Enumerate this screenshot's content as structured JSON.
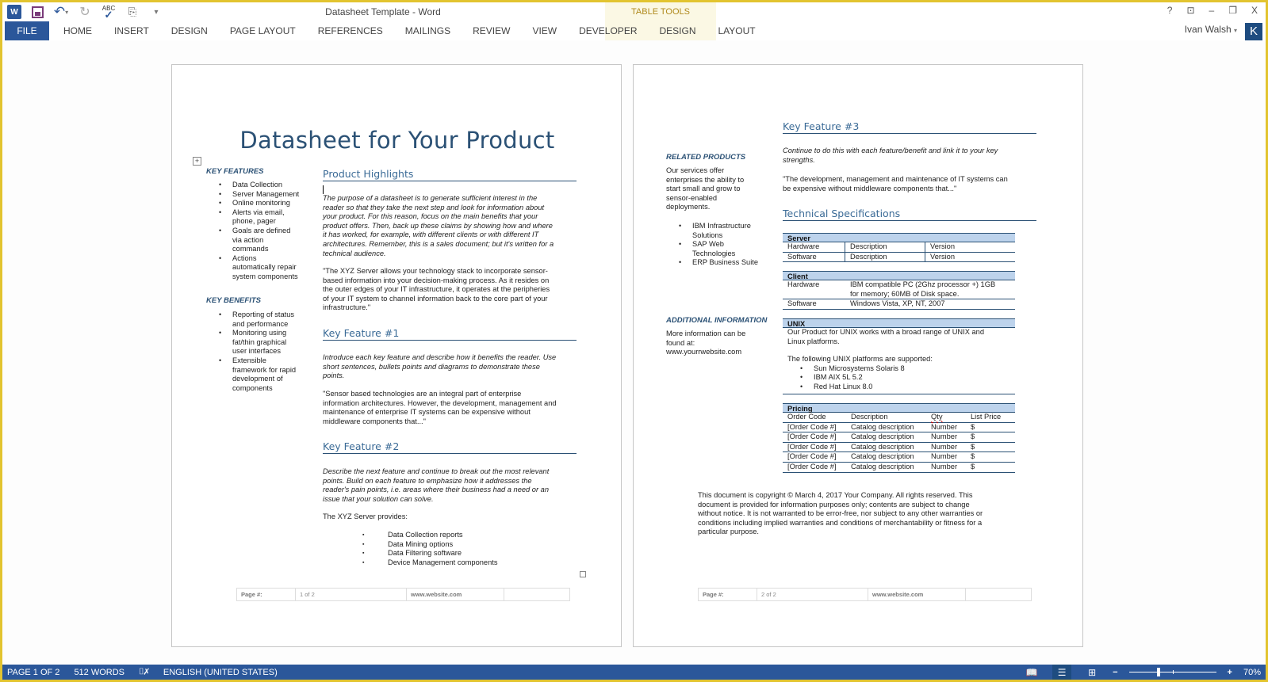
{
  "app": {
    "window_title": "Datasheet Template - Word",
    "table_tools_label": "TABLE TOOLS",
    "user_name": "Ivan Walsh",
    "user_initial": "K",
    "accent_color": "#2b579a",
    "frame_color": "#e2c430"
  },
  "quick_access": {
    "items": [
      "word-logo",
      "save",
      "undo",
      "redo",
      "spelling-check",
      "touch-mode",
      "customize"
    ]
  },
  "window_controls": {
    "help": "?",
    "ribbon_display": "⊡",
    "minimize": "–",
    "restore": "❐",
    "close": "X"
  },
  "ribbon": {
    "tabs": [
      "FILE",
      "HOME",
      "INSERT",
      "DESIGN",
      "PAGE LAYOUT",
      "REFERENCES",
      "MAILINGS",
      "REVIEW",
      "VIEW",
      "DEVELOPER"
    ],
    "contextual_tabs": [
      "DESIGN",
      "LAYOUT"
    ]
  },
  "page1": {
    "title": "Datasheet for Your Product",
    "key_features": {
      "heading": "KEY FEATURES",
      "items": [
        [
          "Data Collection"
        ],
        [
          "Server Management"
        ],
        [
          "Online monitoring"
        ],
        [
          "Alerts via email,",
          "phone, pager"
        ],
        [
          "Goals are defined",
          "via action",
          "commands"
        ],
        [
          "Actions",
          "automatically repair",
          "system components"
        ]
      ]
    },
    "key_benefits": {
      "heading": "KEY BENEFITS",
      "items": [
        [
          "Reporting of status",
          "and performance"
        ],
        [
          "Monitoring using",
          "fat/thin graphical",
          "user interfaces"
        ],
        [
          "Extensible",
          "framework for rapid",
          "development of",
          "components"
        ]
      ]
    },
    "product_highlights": {
      "heading": "Product Highlights",
      "intro_lines": [
        "The purpose of a datasheet is to generate sufficient interest in the",
        "reader so that they take the next step and look for information about",
        "your product. For this reason, focus on the main benefits that your",
        "product offers. Then, back up these claims by showing how and where",
        "it has worked, for example, with different clients or with different IT",
        "architectures. Remember, this is a sales document; but it's written for a",
        "technical audience."
      ],
      "quote_lines": [
        "\"The XYZ Server allows your technology stack to incorporate sensor-",
        "based information into your decision-making process. As it resides on",
        "the outer edges of your IT infrastructure, it operates at the peripheries",
        "of your IT system to channel information back to the core part of your",
        "infrastructure.\""
      ]
    },
    "key_feature_1": {
      "heading": "Key Feature #1",
      "intro_lines": [
        "Introduce each key feature and describe how it benefits the reader. Use",
        "short sentences, bullets points and diagrams to demonstrate these",
        "points."
      ],
      "quote_lines": [
        "\"Sensor based technologies are an integral part of enterprise",
        "information architectures. However, the development, management and",
        "maintenance of enterprise IT systems can be expensive without",
        "middleware components that...\""
      ]
    },
    "key_feature_2": {
      "heading": "Key Feature #2",
      "intro_lines": [
        "Describe the next feature and continue to break out the most relevant",
        "points. Build on each feature to emphasize how it addresses the",
        "reader's pain points, i.e. areas where their business had a need or an",
        "issue that your solution can solve."
      ],
      "provides_label": "The XYZ Server provides:",
      "provides_items": [
        "Data Collection reports",
        "Data Mining options",
        "Data Filtering software",
        "Device Management components"
      ]
    },
    "footer": {
      "page_label": "Page #:",
      "page_value": "1 of 2",
      "website": "www.website.com",
      "extra": ""
    }
  },
  "page2": {
    "related_products": {
      "heading": "RELATED PRODUCTS",
      "text_lines": [
        "Our services offer",
        "enterprises the ability to",
        "start small and grow to",
        "sensor-enabled",
        "deployments."
      ],
      "items": [
        [
          "IBM Infrastructure",
          "Solutions"
        ],
        [
          "SAP Web",
          "Technologies"
        ],
        [
          "ERP Business Suite"
        ]
      ]
    },
    "additional_info": {
      "heading": "ADDITIONAL INFORMATION",
      "text_lines": [
        "More information can be",
        "found at:",
        "www.yourrwebsite.com"
      ]
    },
    "key_feature_3": {
      "heading": "Key Feature #3",
      "intro_lines": [
        "Continue to do this with each feature/benefit and link it to your key",
        "strengths."
      ],
      "quote_lines": [
        "\"The development, management and maintenance of IT systems can",
        "be expensive without middleware components that...\""
      ]
    },
    "tech_specs": {
      "heading": "Technical Specifications",
      "server": {
        "title": "Server",
        "rows": [
          [
            "Hardware",
            "Description",
            "Version"
          ],
          [
            "Software",
            "Description",
            "Version"
          ]
        ]
      },
      "client": {
        "title": "Client",
        "rows": [
          {
            "label": "Hardware",
            "lines": [
              "IBM compatible PC (2Ghz processor +) 1GB",
              "for memory; 60MB of Disk space."
            ]
          },
          {
            "label": "Software",
            "lines": [
              "Windows  Vista, XP, NT, 2007"
            ]
          }
        ]
      },
      "unix": {
        "title": "UNIX",
        "text_lines": [
          "Our Product for UNIX works with a broad range of UNIX and",
          "Linux platforms."
        ],
        "supported_label": "The following UNIX platforms are supported:",
        "platforms": [
          "Sun Microsystems Solaris 8",
          "IBM AIX 5L 5.2",
          "Red Hat Linux 8.0"
        ]
      },
      "pricing": {
        "title": "Pricing",
        "columns": [
          "Order Code",
          "Description",
          "Qty",
          "List Price"
        ],
        "rows": [
          [
            "[Order Code #]",
            "Catalog description",
            "Number",
            "$"
          ],
          [
            "[Order Code #]",
            "Catalog description",
            "Number",
            "$"
          ],
          [
            "[Order Code #]",
            "Catalog description",
            "Number",
            "$"
          ],
          [
            "[Order Code #]",
            "Catalog description",
            "Number",
            "$"
          ],
          [
            "[Order Code #]",
            "Catalog description",
            "Number",
            "$"
          ]
        ]
      }
    },
    "copyright_lines": [
      "This document is copyright © March 4, 2017 Your Company. All rights reserved. This",
      "document is provided for information purposes only; contents are subject to change",
      "without notice. It is not warranted to be error-free, nor subject to any other warranties or",
      "conditions including implied warranties and conditions of merchantability or fitness for a",
      "particular purpose."
    ],
    "footer": {
      "page_label": "Page #:",
      "page_value": "2 of 2",
      "website": "www.website.com",
      "extra": ""
    }
  },
  "statusbar": {
    "page": "PAGE 1 OF 2",
    "words": "512 WORDS",
    "language": "ENGLISH (UNITED STATES)",
    "zoom": "70%",
    "zoom_percent": 70,
    "active_view": "print-layout"
  }
}
